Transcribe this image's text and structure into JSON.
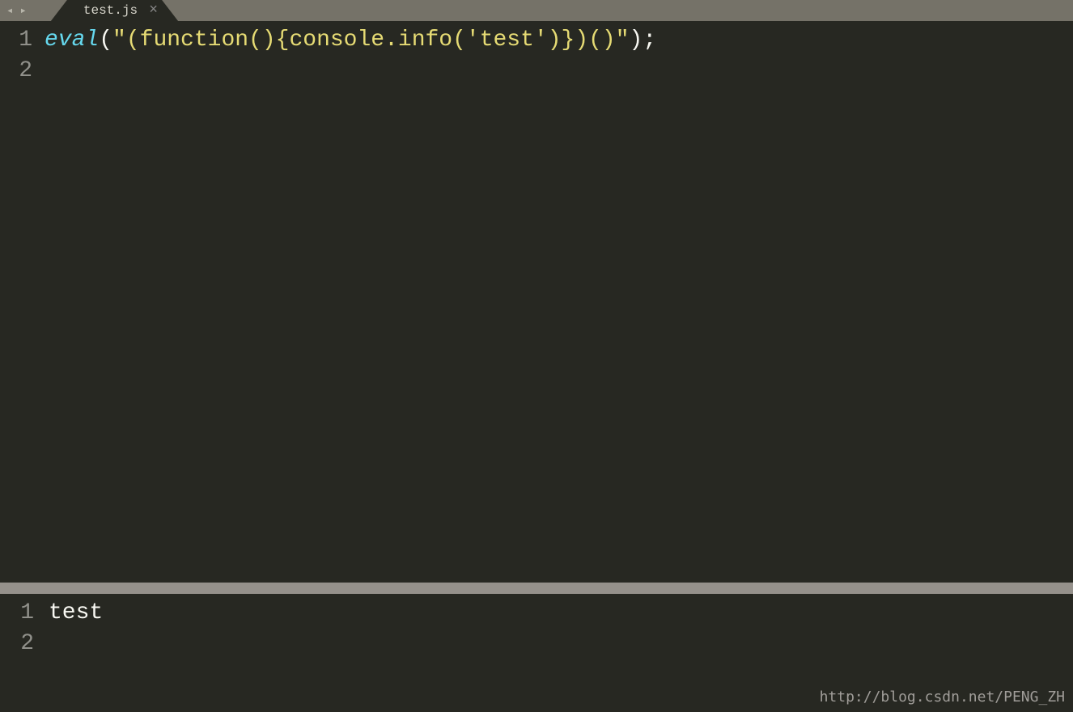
{
  "tab": {
    "filename": "test.js"
  },
  "editor": {
    "lines": [
      {
        "num": "1",
        "tokens": [
          {
            "cls": "tok-keyword",
            "text": "eval"
          },
          {
            "cls": "tok-paren",
            "text": "("
          },
          {
            "cls": "tok-string",
            "text": "\"(function(){console.info('test')})()\""
          },
          {
            "cls": "tok-paren",
            "text": ")"
          },
          {
            "cls": "tok-punct",
            "text": ";"
          }
        ]
      },
      {
        "num": "2",
        "tokens": []
      }
    ]
  },
  "console": {
    "lines": [
      {
        "num": "1",
        "text": "test"
      },
      {
        "num": "2",
        "text": ""
      }
    ]
  },
  "watermark": "http://blog.csdn.net/PENG_ZH"
}
